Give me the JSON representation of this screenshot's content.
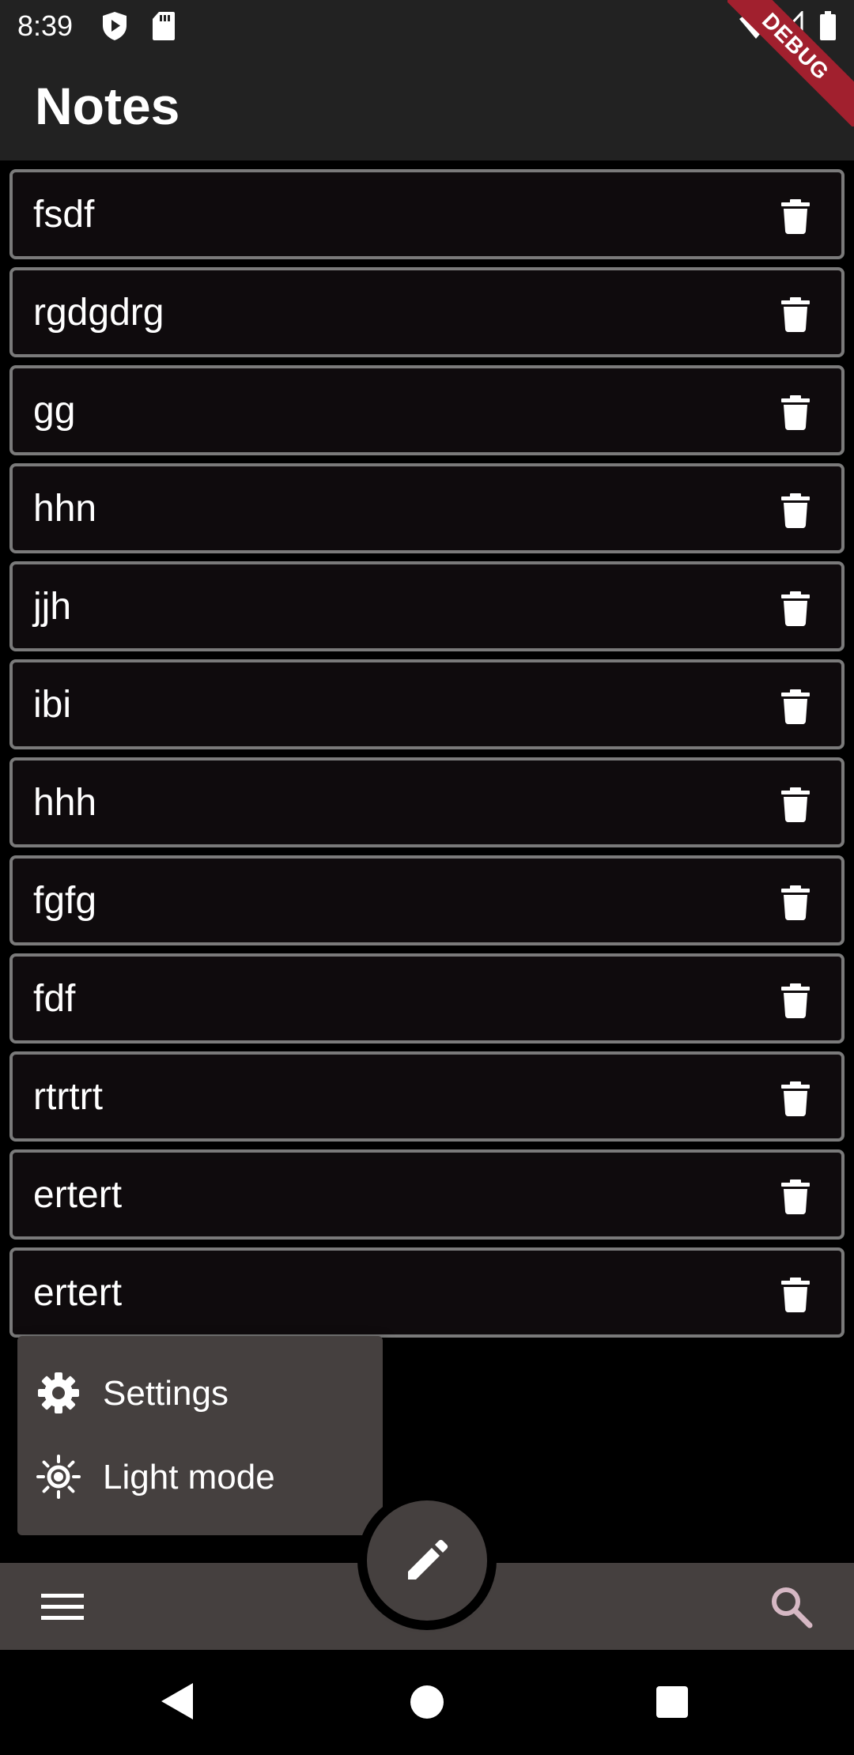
{
  "status_bar": {
    "time": "8:39",
    "icons": [
      "shield-icon",
      "sd-card-icon",
      "wifi-icon",
      "signal-icon",
      "battery-icon"
    ]
  },
  "app_bar": {
    "title": "Notes"
  },
  "debug_banner": {
    "label": "DEBUG",
    "color": "#a1202e"
  },
  "notes": [
    {
      "title": "fsdf"
    },
    {
      "title": "rgdgdrg"
    },
    {
      "title": "gg"
    },
    {
      "title": "hhn"
    },
    {
      "title": "jjh"
    },
    {
      "title": "ibi"
    },
    {
      "title": "hhh"
    },
    {
      "title": "fgfg"
    },
    {
      "title": "fdf"
    },
    {
      "title": "rtrtrt"
    },
    {
      "title": "ertert"
    },
    {
      "title": "ertert"
    }
  ],
  "popup_menu": {
    "items": [
      {
        "label": "Settings",
        "icon": "gear-icon"
      },
      {
        "label": "Light mode",
        "icon": "sun-icon"
      }
    ]
  },
  "bottom_bar": {
    "menu_icon": "hamburger-menu-icon",
    "fab_icon": "pencil-icon",
    "search_icon": "search-icon"
  },
  "nav_bar": {
    "buttons": [
      "back-icon",
      "home-icon",
      "recents-icon"
    ]
  },
  "colors": {
    "app_bar_background": "#222222",
    "card_background": "#0f0b0d",
    "card_border": "#7a7a7a",
    "surface": "#45403f",
    "search_icon": "#d6b8c4"
  }
}
